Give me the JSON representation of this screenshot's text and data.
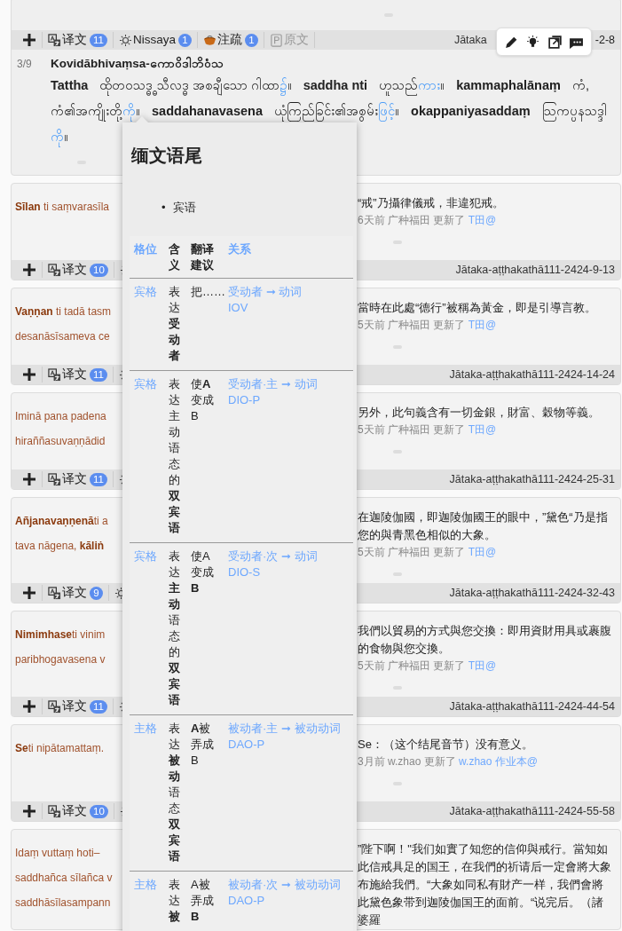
{
  "top_card": {
    "tabs": [
      {
        "kind": "translation",
        "label": "译文",
        "count": "11",
        "disabled": false
      },
      {
        "kind": "nissaya",
        "label": "Nissaya",
        "count": "1",
        "disabled": false
      },
      {
        "kind": "commentary",
        "label": "注疏",
        "count": "1",
        "disabled": false
      },
      {
        "kind": "original",
        "label": "原文",
        "disabled": true
      }
    ],
    "source_parts": [
      "Jātaka",
      "-2-8"
    ],
    "number": "3/9",
    "title": "Kovidābhivaṃsa-ကောဝိဒါဘိဝံသ",
    "nissaya": [
      {
        "kind": "pali",
        "text": "Tattha"
      },
      {
        "kind": "gloss",
        "text": "ထိုတဝသဒ္ဓ္ဓ သီလဒ္ဓ အစချီသော ဂါထာ"
      },
      {
        "kind": "suffix",
        "text": "၌"
      },
      {
        "kind": "gloss",
        "text": "။"
      },
      {
        "kind": "pali",
        "text": "saddha nti"
      },
      {
        "kind": "gloss",
        "text": "ဟူသည်"
      },
      {
        "kind": "suffix",
        "text": "ကား"
      },
      {
        "kind": "gloss",
        "text": "။"
      },
      {
        "kind": "pali",
        "text": "kammaphalānaṃ"
      },
      {
        "kind": "gloss",
        "text": "ကံ, ကံ၏အကျိုးတို့"
      },
      {
        "kind": "suffix",
        "text": "ကို"
      },
      {
        "kind": "gloss",
        "text": "။"
      },
      {
        "kind": "pali",
        "text": "saddahanavasena"
      },
      {
        "kind": "gloss",
        "text": "ယုံကြည်ခြင်း၏အစွမ်း"
      },
      {
        "kind": "suffix",
        "text": "ဖြင့်"
      },
      {
        "kind": "gloss",
        "text": "။"
      },
      {
        "kind": "pali",
        "text": "okappaniyasaddaṃ"
      },
      {
        "kind": "gloss",
        "text": "သြကပ္ပနသဒ္ဒါ"
      },
      {
        "kind": "suffix",
        "text": "ကို"
      },
      {
        "kind": "gloss",
        "text": "။"
      }
    ]
  },
  "popup": {
    "title": "缅文语尾",
    "bullets": [
      {
        "marker": "•",
        "text": "宾语"
      }
    ],
    "columns": [
      "格位",
      "含义",
      "翻译建议",
      "关系"
    ],
    "rows": [
      {
        "case": "宾格",
        "meaning": "表达**受动者**",
        "suggestion": "把……",
        "relation": "受动者 ➞ 动词",
        "code": "IOV"
      },
      {
        "case": "宾格",
        "meaning": "表达主动语态的**双宾语**",
        "suggestion": "使**A**变成B",
        "relation": "受动者·主 ➞ 动词",
        "code": "DIO-P"
      },
      {
        "case": "宾格",
        "meaning": "表达**主动**语态的**双宾语**",
        "suggestion": "使A变成**B**",
        "relation": "受动者·次 ➞ 动词",
        "code": "DIO-S"
      },
      {
        "case": "主格",
        "meaning": "表达**被动**语态**双宾语**",
        "suggestion": "**A**被弄成B",
        "relation": "被动者·主 ➞ 被动动词",
        "code": "DAO-P"
      },
      {
        "case": "主格",
        "meaning": "表达**被**",
        "suggestion": "A被弄成**B**",
        "relation": "被动者·次 ➞ 被动动词",
        "code": "DAO-P"
      }
    ]
  },
  "cards": [
    {
      "pali": [
        "**Sīlan** ti saṃvarasīla"
      ],
      "translation": "“戒”乃攝律儀戒，非違犯戒。",
      "meta": "6天前 广种福田 更新了",
      "link": "T田@",
      "tab": {
        "label": "译文",
        "count": "10"
      },
      "source": "Jātaka-aṭṭhakathā111-2424-9-13"
    },
    {
      "pali": [
        "**Vaṇṇan** ti tadā tasm",
        "desanāsīsameva ce"
      ],
      "translation": "當時在此處“德行”被稱為黃金，即是引導言教。",
      "meta": "5天前 广种福田 更新了",
      "link": "T田@",
      "tab": {
        "label": "译文",
        "count": "11"
      },
      "source": "Jātaka-aṭṭhakathā111-2424-14-24"
    },
    {
      "pali": [
        "Iminā pana padena",
        "hiraññasuvaṇṇādid"
      ],
      "translation": "另外，此句義含有一切金銀，財富、穀物等義。",
      "meta": "5天前 广种福田 更新了",
      "link": "T田@",
      "tab": {
        "label": "译文",
        "count": "11"
      },
      "source": "Jātaka-aṭṭhakathā111-2424-25-31"
    },
    {
      "pali": [
        "**Añjanavaṇṇenā**ti a",
        "tava nāgena, **kāliṅ**"
      ],
      "translation": "在迦陵伽國，即迦陵伽國王的眼中，”黛色“乃是指您的與青黑色相似的大象。",
      "meta": "5天前 广种福田 更新了",
      "link": "T田@",
      "tab": {
        "label": "译文",
        "count": "9"
      },
      "source": "Jātaka-aṭṭhakathā111-2424-32-43"
    },
    {
      "pali": [
        "**Nimimhase**ti vinim",
        "paribhogavasena v"
      ],
      "translation": "我們以貿易的方式與您交換：即用資財用具或裹腹的食物與您交換。",
      "meta": "5天前 广种福田 更新了",
      "link": "T田@",
      "tab": {
        "label": "译文",
        "count": "11"
      },
      "source": "Jātaka-aṭṭhakathā111-2424-44-54"
    },
    {
      "pali": [
        "**Se**ti nipātamattaṃ."
      ],
      "translation": "Se：（这个结尾音节）没有意义。",
      "meta": "3月前 w.zhao 更新了",
      "link": "w.zhao 作业本@",
      "tab": {
        "label": "译文",
        "count": "10"
      },
      "source": "Jātaka-aṭṭhakathā111-2424-55-58"
    },
    {
      "pali": [
        "Idaṃ vuttaṃ hoti–",
        "saddhañca sīlañca v",
        "saddhāsīlasampann"
      ],
      "translation": "”陛下啊！\"我们如實了知您的信仰與戒行。當知如此信戒具足的国王，在我們的祈请后一定會將大象布施給我們。“大象如同私有財产一样，我們會將此黛色象带到迦陵伽国王的面前。“说完后。（諸婆羅"
    }
  ]
}
